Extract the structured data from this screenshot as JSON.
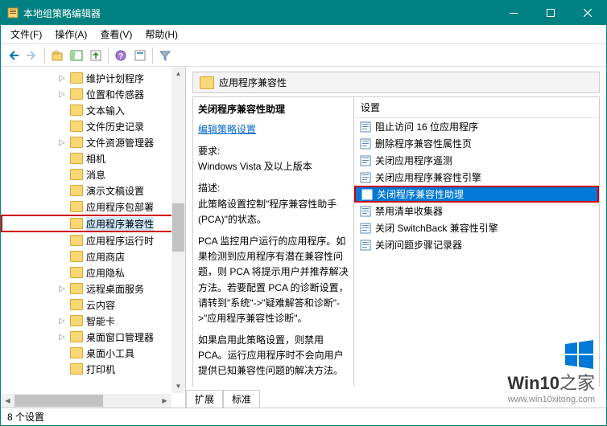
{
  "window": {
    "title": "本地组策略编辑器"
  },
  "menu": {
    "file": "文件(F)",
    "action": "操作(A)",
    "view": "查看(V)",
    "help": "帮助(H)"
  },
  "tree": {
    "items": [
      {
        "label": "维护计划程序",
        "exp": "▷"
      },
      {
        "label": "位置和传感器",
        "exp": "▷"
      },
      {
        "label": "文本输入",
        "exp": ""
      },
      {
        "label": "文件历史记录",
        "exp": ""
      },
      {
        "label": "文件资源管理器",
        "exp": "▷"
      },
      {
        "label": "相机",
        "exp": ""
      },
      {
        "label": "消息",
        "exp": ""
      },
      {
        "label": "演示文稿设置",
        "exp": ""
      },
      {
        "label": "应用程序包部署",
        "exp": ""
      },
      {
        "label": "应用程序兼容性",
        "exp": "",
        "highlight": true
      },
      {
        "label": "应用程序运行时",
        "exp": ""
      },
      {
        "label": "应用商店",
        "exp": ""
      },
      {
        "label": "应用隐私",
        "exp": ""
      },
      {
        "label": "远程桌面服务",
        "exp": "▷"
      },
      {
        "label": "云内容",
        "exp": ""
      },
      {
        "label": "智能卡",
        "exp": "▷"
      },
      {
        "label": "桌面窗口管理器",
        "exp": "▷"
      },
      {
        "label": "桌面小工具",
        "exp": ""
      },
      {
        "label": "打印机",
        "exp": ""
      }
    ]
  },
  "details": {
    "header_title": "应用程序兼容性",
    "setting_title": "关闭程序兼容性助理",
    "edit_link": "编辑策略设置",
    "req_label": "要求:",
    "req_text": "Windows Vista 及以上版本",
    "desc_label": "描述:",
    "desc_p1": "此策略设置控制\"程序兼容性助手(PCA)\"的状态。",
    "desc_p2": "PCA 监控用户运行的应用程序。如果检测到应用程序有潜在兼容性问题，则 PCA 将提示用户并推荐解决方法。若要配置 PCA 的诊断设置，请转到\"系统\"->\"疑难解答和诊断\"->\"应用程序兼容性诊断\"。",
    "desc_p3": "如果启用此策略设置，则禁用 PCA。运行应用程序时不会向用户提供已知兼容性问题的解决方法。"
  },
  "list": {
    "header": "设置",
    "items": [
      {
        "label": "阻止访问 16 位应用程序"
      },
      {
        "label": "删除程序兼容性属性页"
      },
      {
        "label": "关闭应用程序遥测"
      },
      {
        "label": "关闭应用程序兼容性引擎"
      },
      {
        "label": "关闭程序兼容性助理",
        "selected": true
      },
      {
        "label": "禁用清单收集器"
      },
      {
        "label": "关闭 SwitchBack 兼容性引擎"
      },
      {
        "label": "关闭问题步骤记录器"
      }
    ]
  },
  "tabs": {
    "extended": "扩展",
    "standard": "标准"
  },
  "statusbar": {
    "text": "8 个设置"
  },
  "watermark": {
    "brand1": "Win10",
    "brand2": "之家",
    "url": "www.win10xitong.com"
  }
}
